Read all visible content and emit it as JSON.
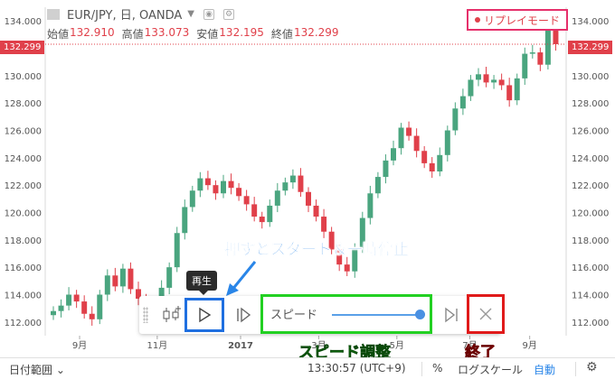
{
  "header": {
    "symbol": "EUR/JPY, 日, OANDA",
    "ohlc": [
      {
        "label": "始値",
        "value": "132.910"
      },
      {
        "label": "高値",
        "value": "133.073"
      },
      {
        "label": "安値",
        "value": "132.195"
      },
      {
        "label": "終値",
        "value": "132.299"
      }
    ]
  },
  "replay_mode_label": "リプレイモード",
  "current_price": "132.299",
  "annotations": {
    "main": "押すとスタート＆一時停止",
    "speed": "スピード調整",
    "end": "終了"
  },
  "replay_bar": {
    "tooltip": "再生",
    "speed_label": "スピード",
    "speed_level": 1.0,
    "icons": {
      "select_bar": "candle-select-icon",
      "play": "play-icon",
      "step": "step-forward-icon",
      "forward": "jump-to-real-time-icon",
      "close": "close-icon"
    }
  },
  "bottom_bar": {
    "date_range": "日付範囲",
    "time": "13:30:57 (UTC+9)",
    "percent": "%",
    "log_scale": "ログスケール",
    "auto": "自動"
  },
  "colors": {
    "up": "#4aa57f",
    "down": "#e0404a",
    "accent_play": "#1f6fe0",
    "accent_speed": "#22d022",
    "accent_close": "#e01a1a",
    "replay_badge": "#e6306b"
  },
  "chart_data": {
    "type": "candlestick",
    "y_axis_ticks": [
      "112.000",
      "114.000",
      "116.000",
      "118.000",
      "120.000",
      "122.000",
      "124.000",
      "126.000",
      "128.000",
      "130.000",
      "132.000",
      "134.000"
    ],
    "ylim": [
      111,
      135
    ],
    "x_axis_ticks": [
      "9月",
      "11月",
      "2017",
      "3月",
      "5月",
      "7月",
      "9月"
    ],
    "series_close_approx": [
      112.8,
      113.2,
      114.0,
      113.5,
      112.6,
      112.2,
      114.0,
      115.4,
      114.6,
      115.9,
      114.4,
      113.7,
      113.1,
      112.4,
      114.5,
      116.0,
      118.5,
      120.4,
      121.6,
      122.5,
      122.0,
      121.4,
      122.3,
      121.8,
      121.2,
      120.6,
      119.7,
      119.3,
      120.5,
      121.6,
      122.2,
      122.7,
      121.5,
      120.5,
      119.7,
      118.6,
      117.3,
      116.2,
      115.7,
      117.4,
      119.6,
      121.4,
      122.6,
      123.8,
      124.7,
      126.2,
      125.6,
      124.5,
      123.6,
      123.0,
      124.2,
      126.0,
      127.6,
      128.5,
      129.7,
      130.1,
      129.5,
      129.7,
      129.3,
      128.2,
      129.8,
      131.6,
      131.7,
      130.8,
      133.7,
      132.3
    ]
  }
}
